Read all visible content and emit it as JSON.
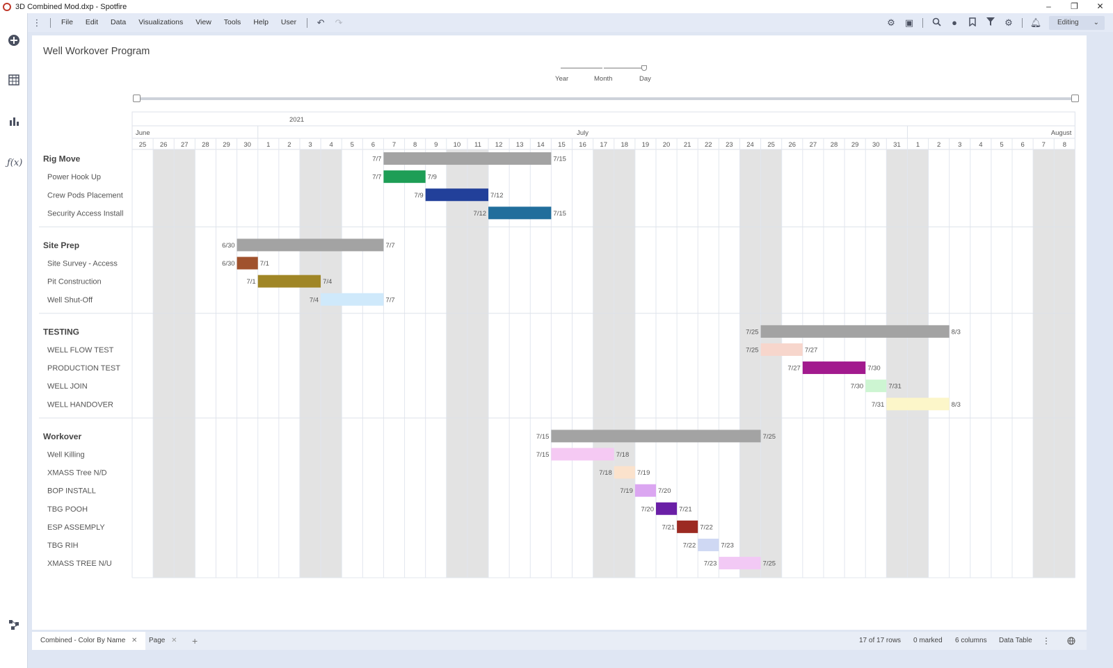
{
  "window": {
    "title": "3D Combined Mod.dxp - Spotfire",
    "minimize": "–",
    "maximize": "❐",
    "close": "✕"
  },
  "menu": {
    "items": [
      "File",
      "Edit",
      "Data",
      "Visualizations",
      "View",
      "Tools",
      "Help",
      "User"
    ],
    "editing_label": "Editing"
  },
  "viz": {
    "title": "Well Workover Program",
    "zoom_levels": [
      "Year",
      "Month",
      "Day"
    ],
    "zoom_selected": "Day"
  },
  "chart_data": {
    "type": "gantt",
    "year": "2021",
    "months": [
      {
        "label": "June",
        "days": [
          "25",
          "26",
          "27",
          "28",
          "29",
          "30"
        ]
      },
      {
        "label": "July",
        "days": [
          "1",
          "2",
          "3",
          "4",
          "5",
          "6",
          "7",
          "8",
          "9",
          "10",
          "11",
          "12",
          "13",
          "14",
          "15",
          "16",
          "17",
          "18",
          "19",
          "20",
          "21",
          "22",
          "23",
          "24",
          "25",
          "26",
          "27",
          "28",
          "29",
          "30",
          "31"
        ]
      },
      {
        "label": "August",
        "days": [
          "1",
          "2",
          "3",
          "4",
          "5",
          "6",
          "7",
          "8"
        ]
      }
    ],
    "weekend_day_indices": [
      1,
      2,
      8,
      9,
      15,
      16,
      22,
      23,
      29,
      30,
      36,
      37,
      43,
      44
    ],
    "groups": [
      {
        "name": "Rig Move",
        "start": "2021-07-07",
        "end": "2021-07-15",
        "start_label": "7/7",
        "end_label": "7/15",
        "color": "#a3a3a3",
        "tasks": [
          {
            "name": "Power Hook Up",
            "start": "2021-07-07",
            "end": "2021-07-09",
            "start_label": "7/7",
            "end_label": "7/9",
            "color": "#1e9e56"
          },
          {
            "name": "Crew Pods Placement",
            "start": "2021-07-09",
            "end": "2021-07-12",
            "start_label": "7/9",
            "end_label": "7/12",
            "color": "#22409a"
          },
          {
            "name": "Security Access Install",
            "start": "2021-07-12",
            "end": "2021-07-15",
            "start_label": "7/12",
            "end_label": "7/15",
            "color": "#216e9c"
          }
        ]
      },
      {
        "name": "Site Prep",
        "start": "2021-06-30",
        "end": "2021-07-07",
        "start_label": "6/30",
        "end_label": "7/7",
        "color": "#a3a3a3",
        "tasks": [
          {
            "name": "Site Survey - Access",
            "start": "2021-06-30",
            "end": "2021-07-01",
            "start_label": "6/30",
            "end_label": "7/1",
            "color": "#a0522d"
          },
          {
            "name": "Pit Construction",
            "start": "2021-07-01",
            "end": "2021-07-04",
            "start_label": "7/1",
            "end_label": "7/4",
            "color": "#a08626"
          },
          {
            "name": "Well Shut-Off",
            "start": "2021-07-04",
            "end": "2021-07-07",
            "start_label": "7/4",
            "end_label": "7/7",
            "color": "#cfe9fb"
          }
        ]
      },
      {
        "name": "TESTING",
        "start": "2021-07-25",
        "end": "2021-08-03",
        "start_label": "7/25",
        "end_label": "8/3",
        "color": "#a3a3a3",
        "tasks": [
          {
            "name": "WELL FLOW TEST",
            "start": "2021-07-25",
            "end": "2021-07-27",
            "start_label": "7/25",
            "end_label": "7/27",
            "color": "#f7d6cc"
          },
          {
            "name": "PRODUCTION TEST",
            "start": "2021-07-27",
            "end": "2021-07-30",
            "start_label": "7/27",
            "end_label": "7/30",
            "color": "#a21a8e"
          },
          {
            "name": "WELL JOIN",
            "start": "2021-07-30",
            "end": "2021-07-31",
            "start_label": "7/30",
            "end_label": "7/31",
            "color": "#cdf5d2"
          },
          {
            "name": "WELL HANDOVER",
            "start": "2021-07-31",
            "end": "2021-08-03",
            "start_label": "7/31",
            "end_label": "8/3",
            "color": "#fcf6c9"
          }
        ]
      },
      {
        "name": "Workover",
        "start": "2021-07-15",
        "end": "2021-07-25",
        "start_label": "7/15",
        "end_label": "7/25",
        "color": "#a3a3a3",
        "tasks": [
          {
            "name": "Well Killing",
            "start": "2021-07-15",
            "end": "2021-07-18",
            "start_label": "7/15",
            "end_label": "7/18",
            "color": "#f5c9f3"
          },
          {
            "name": "XMASS Tree N/D",
            "start": "2021-07-18",
            "end": "2021-07-19",
            "start_label": "7/18",
            "end_label": "7/19",
            "color": "#fbe2cc"
          },
          {
            "name": "BOP INSTALL",
            "start": "2021-07-19",
            "end": "2021-07-20",
            "start_label": "7/19",
            "end_label": "7/20",
            "color": "#dba6f1"
          },
          {
            "name": "TBG POOH",
            "start": "2021-07-20",
            "end": "2021-07-21",
            "start_label": "7/20",
            "end_label": "7/21",
            "color": "#6a1fa6"
          },
          {
            "name": "ESP ASSEMPLY",
            "start": "2021-07-21",
            "end": "2021-07-22",
            "start_label": "7/21",
            "end_label": "7/22",
            "color": "#9c2a22"
          },
          {
            "name": "TBG RIH",
            "start": "2021-07-22",
            "end": "2021-07-23",
            "start_label": "7/22",
            "end_label": "7/23",
            "color": "#cfd8f3"
          },
          {
            "name": "XMASS TREE N/U",
            "start": "2021-07-23",
            "end": "2021-07-25",
            "start_label": "7/23",
            "end_label": "7/25",
            "color": "#f2c9f5"
          }
        ]
      }
    ]
  },
  "status": {
    "tabs": [
      {
        "label": "Combined - Color By Name",
        "close": "✕"
      },
      {
        "label": "Page",
        "close": "✕"
      }
    ],
    "add_tab": "+",
    "rows": "17 of 17 rows",
    "marked": "0 marked",
    "columns": "6 columns",
    "table": "Data Table",
    "more": "⋮"
  }
}
